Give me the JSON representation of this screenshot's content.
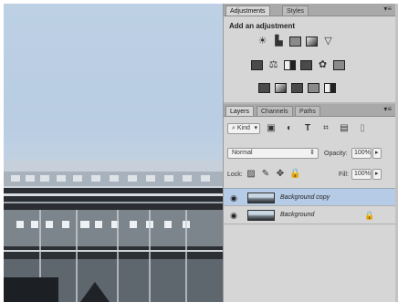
{
  "adjustments_panel": {
    "tabs": [
      {
        "label": "Adjustments",
        "active": true
      },
      {
        "label": "Styles",
        "active": false
      }
    ],
    "heading": "Add an adjustment",
    "icon_rows": [
      [
        "brightness-contrast-icon",
        "levels-icon",
        "curves-icon",
        "exposure-icon",
        "vibrance-icon"
      ],
      [
        "hue-saturation-icon",
        "color-balance-icon",
        "black-white-icon",
        "photo-filter-icon",
        "channel-mixer-icon",
        "color-lookup-icon"
      ],
      [
        "invert-icon",
        "posterize-icon",
        "threshold-icon",
        "gradient-map-icon",
        "selective-color-icon"
      ]
    ]
  },
  "layers_panel": {
    "tabs": [
      {
        "label": "Layers",
        "active": true
      },
      {
        "label": "Channels",
        "active": false
      },
      {
        "label": "Paths",
        "active": false
      }
    ],
    "filter_kind": "Kind",
    "blend_mode": "Normal",
    "opacity_label": "Opacity:",
    "opacity_value": "100%",
    "lock_label": "Lock:",
    "fill_label": "Fill:",
    "fill_value": "100%",
    "layers": [
      {
        "name": "Background copy",
        "selected": true,
        "locked": false
      },
      {
        "name": "Background",
        "selected": false,
        "locked": true
      }
    ]
  },
  "colors": {
    "selection": "#b6cbe6",
    "panel_bg": "#d6d6d6",
    "tab_bar": "#a9a9a9"
  }
}
